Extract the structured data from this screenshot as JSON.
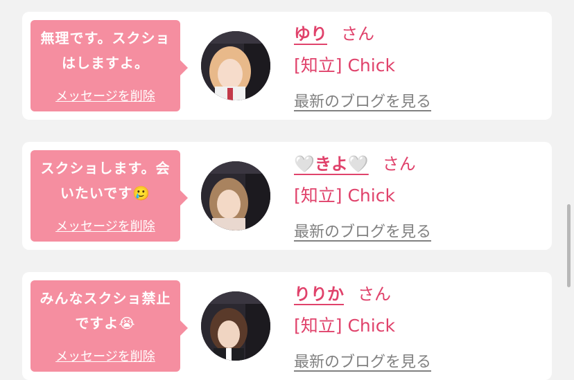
{
  "cards": [
    {
      "message": "無理です。スクショはしますよ。",
      "delete_label": "メッセージを削除",
      "name": "ゆり",
      "honorific": "さん",
      "shop": "[知立] Chick",
      "blog_link": "最新のブログを見る"
    },
    {
      "message": "スクショします。会いたいです🥲",
      "delete_label": "メッセージを削除",
      "name": "🤍きよ🤍",
      "honorific": "さん",
      "shop": "[知立] Chick",
      "blog_link": "最新のブログを見る"
    },
    {
      "message": "みんなスクショ禁止ですよ😭",
      "delete_label": "メッセージを削除",
      "name": "りりか",
      "honorific": "さん",
      "shop": "[知立] Chick",
      "blog_link": "最新のブログを見る"
    }
  ],
  "colors": {
    "bubble": "#f58ea0",
    "accent": "#e0426b",
    "link_gray": "#808080"
  }
}
